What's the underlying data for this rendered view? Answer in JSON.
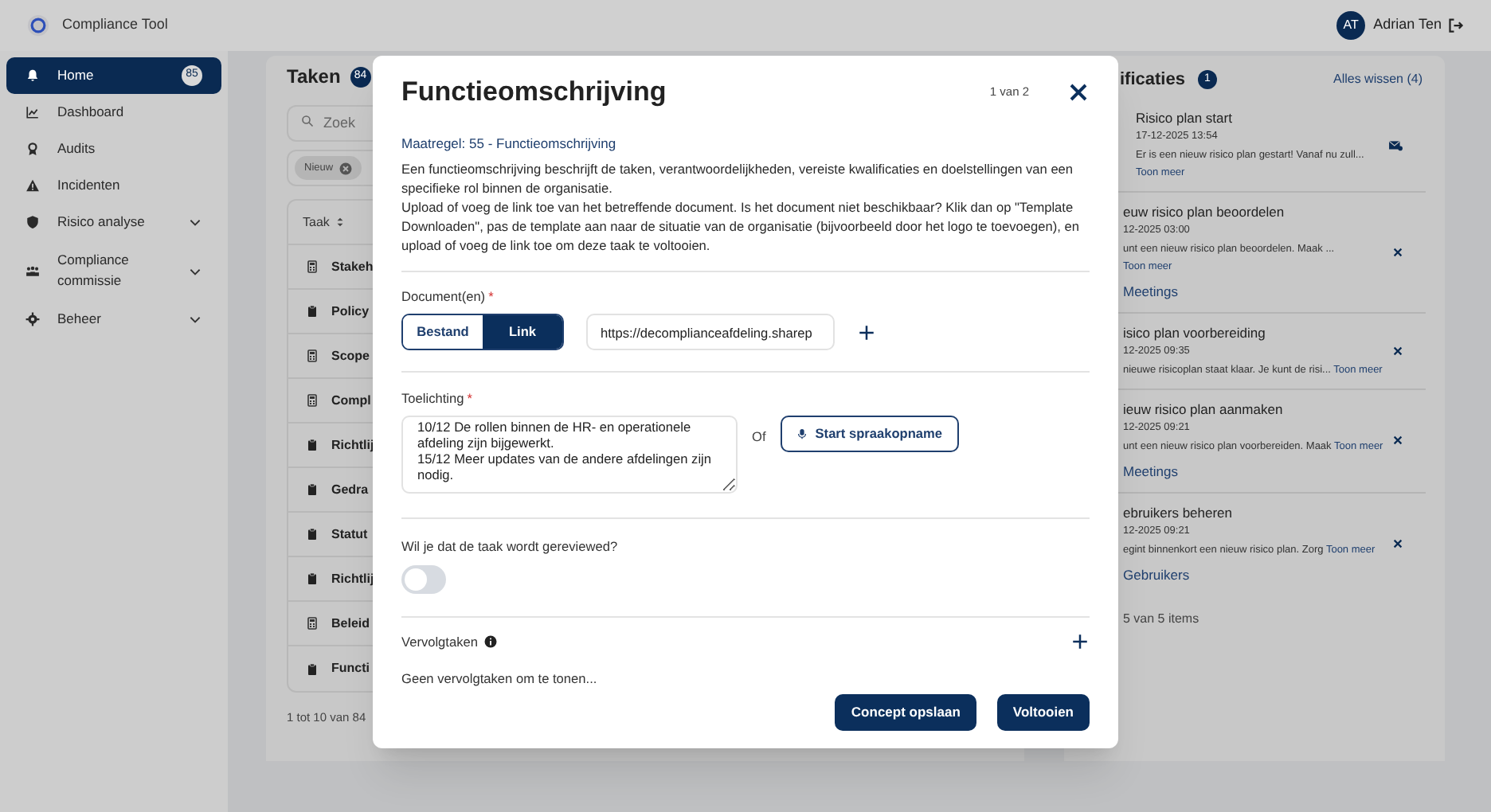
{
  "app": {
    "title": "Compliance Tool"
  },
  "user": {
    "initials": "AT",
    "name": "Adrian Ten"
  },
  "sidebar": {
    "items": [
      {
        "label": "Home",
        "badge": "85",
        "selected": true,
        "expandable": false
      },
      {
        "label": "Dashboard",
        "selected": false,
        "expandable": false
      },
      {
        "label": "Audits",
        "selected": false,
        "expandable": false
      },
      {
        "label": "Incidenten",
        "selected": false,
        "expandable": false
      },
      {
        "label": "Risico analyse",
        "selected": false,
        "expandable": true
      },
      {
        "label": "Compliance commissie",
        "selected": false,
        "expandable": true
      },
      {
        "label": "Beheer",
        "selected": false,
        "expandable": true
      }
    ]
  },
  "tasks": {
    "title": "Taken",
    "count": "84",
    "search_placeholder": "Zoek",
    "filters": [
      {
        "label": "Nieuw"
      }
    ],
    "column": "Taak",
    "rows": [
      {
        "label": "Stakeh",
        "kind": "calculator"
      },
      {
        "label": "Policy",
        "kind": "clipboard"
      },
      {
        "label": "Scope",
        "kind": "calculator"
      },
      {
        "label": "Compl",
        "kind": "calculator"
      },
      {
        "label": "Richtlij",
        "kind": "clipboard"
      },
      {
        "label": "Gedra",
        "kind": "clipboard"
      },
      {
        "label": "Statut",
        "kind": "clipboard"
      },
      {
        "label": "Richtlij",
        "kind": "clipboard"
      },
      {
        "label": "Beleid",
        "kind": "calculator"
      },
      {
        "label": "Functi",
        "kind": "clipboard"
      }
    ],
    "footer": "1 tot 10 van 84"
  },
  "notifications": {
    "title": "ificaties",
    "count": "1",
    "clear_all": "Alles wissen (4)",
    "items": [
      {
        "title": "Risico plan start",
        "date": "17-12-2025 13:54",
        "text": "Er is een nieuw risico plan gestart! Vanaf nu zull...",
        "more": "Toon meer",
        "kind": "mail"
      },
      {
        "title": "euw risico plan beoordelen",
        "date": "12-2025 03:00",
        "text": "unt een nieuw risico plan beoordelen. Maak ...",
        "more": "Toon meer",
        "link": "Meetings",
        "kind": "dismiss"
      },
      {
        "title": "isico plan voorbereiding",
        "date": "12-2025 09:35",
        "text": "nieuwe risicoplan staat klaar. Je kunt de risi...",
        "more": "Toon meer",
        "kind": "dismiss"
      },
      {
        "title": "ieuw risico plan aanmaken",
        "date": "12-2025 09:21",
        "text": "unt een nieuw risico plan voorbereiden. Maak",
        "more": "Toon meer",
        "link": "Meetings",
        "kind": "dismiss"
      },
      {
        "title": "ebruikers beheren",
        "date": "12-2025 09:21",
        "text": "egint binnenkort een nieuw risico plan. Zorg",
        "more": "Toon meer",
        "link": "Gebruikers",
        "kind": "dismiss"
      }
    ],
    "footer": "5 van 5 items"
  },
  "modal": {
    "title": "Functieomschrijving",
    "pager": "1 van 2",
    "measure": "Maatregel: 55 - Functieomschrijving",
    "description": [
      "Een functieomschrijving beschrijft de taken, verantwoordelijkheden, vereiste kwalificaties en doelstellingen van een specifieke rol binnen de organisatie.",
      "Upload of voeg de link toe van het betreffende document. Is het document niet beschikbaar? Klik dan op \"Template Downloaden\", pas de template aan naar de situatie van de organisatie (bijvoorbeeld door het logo te toevoegen), en upload of voeg de link toe om deze taak te voltooien."
    ],
    "documents": {
      "label": "Document(en)",
      "required_mark": "*",
      "tabs": [
        {
          "label": "Bestand",
          "selected": false
        },
        {
          "label": "Link",
          "selected": true
        }
      ],
      "link_value": "https://decomplianceafdeling.sharep"
    },
    "explanation": {
      "label": "Toelichting",
      "required_mark": "*",
      "value": "10/12 De rollen binnen de HR- en operationele afdeling zijn bijgewerkt.\n15/12 Meer updates van de andere afdelingen zijn nodig.",
      "or": "Of",
      "voice_button": "Start spraakopname"
    },
    "review": {
      "question": "Wil je dat de taak wordt gereviewed?",
      "on": false
    },
    "followups": {
      "label": "Vervolgtaken",
      "empty": "Geen vervolgtaken om te tonen..."
    },
    "buttons": [
      "Concept opslaan",
      "Voltooien"
    ]
  }
}
